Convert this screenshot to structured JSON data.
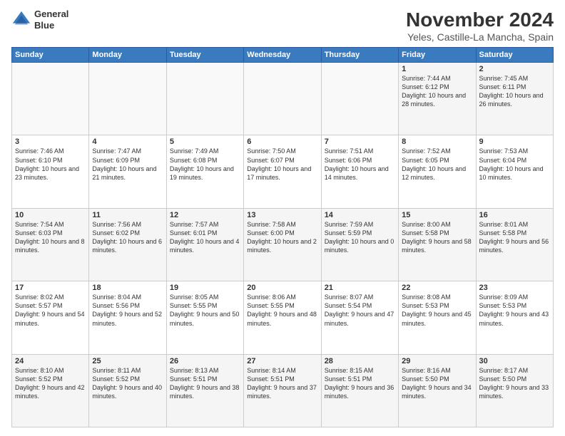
{
  "header": {
    "logo_line1": "General",
    "logo_line2": "Blue",
    "title": "November 2024",
    "subtitle": "Yeles, Castille-La Mancha, Spain"
  },
  "weekdays": [
    "Sunday",
    "Monday",
    "Tuesday",
    "Wednesday",
    "Thursday",
    "Friday",
    "Saturday"
  ],
  "weeks": [
    [
      {
        "day": "",
        "sunrise": "",
        "sunset": "",
        "daylight": ""
      },
      {
        "day": "",
        "sunrise": "",
        "sunset": "",
        "daylight": ""
      },
      {
        "day": "",
        "sunrise": "",
        "sunset": "",
        "daylight": ""
      },
      {
        "day": "",
        "sunrise": "",
        "sunset": "",
        "daylight": ""
      },
      {
        "day": "",
        "sunrise": "",
        "sunset": "",
        "daylight": ""
      },
      {
        "day": "1",
        "sunrise": "Sunrise: 7:44 AM",
        "sunset": "Sunset: 6:12 PM",
        "daylight": "Daylight: 10 hours and 28 minutes."
      },
      {
        "day": "2",
        "sunrise": "Sunrise: 7:45 AM",
        "sunset": "Sunset: 6:11 PM",
        "daylight": "Daylight: 10 hours and 26 minutes."
      }
    ],
    [
      {
        "day": "3",
        "sunrise": "Sunrise: 7:46 AM",
        "sunset": "Sunset: 6:10 PM",
        "daylight": "Daylight: 10 hours and 23 minutes."
      },
      {
        "day": "4",
        "sunrise": "Sunrise: 7:47 AM",
        "sunset": "Sunset: 6:09 PM",
        "daylight": "Daylight: 10 hours and 21 minutes."
      },
      {
        "day": "5",
        "sunrise": "Sunrise: 7:49 AM",
        "sunset": "Sunset: 6:08 PM",
        "daylight": "Daylight: 10 hours and 19 minutes."
      },
      {
        "day": "6",
        "sunrise": "Sunrise: 7:50 AM",
        "sunset": "Sunset: 6:07 PM",
        "daylight": "Daylight: 10 hours and 17 minutes."
      },
      {
        "day": "7",
        "sunrise": "Sunrise: 7:51 AM",
        "sunset": "Sunset: 6:06 PM",
        "daylight": "Daylight: 10 hours and 14 minutes."
      },
      {
        "day": "8",
        "sunrise": "Sunrise: 7:52 AM",
        "sunset": "Sunset: 6:05 PM",
        "daylight": "Daylight: 10 hours and 12 minutes."
      },
      {
        "day": "9",
        "sunrise": "Sunrise: 7:53 AM",
        "sunset": "Sunset: 6:04 PM",
        "daylight": "Daylight: 10 hours and 10 minutes."
      }
    ],
    [
      {
        "day": "10",
        "sunrise": "Sunrise: 7:54 AM",
        "sunset": "Sunset: 6:03 PM",
        "daylight": "Daylight: 10 hours and 8 minutes."
      },
      {
        "day": "11",
        "sunrise": "Sunrise: 7:56 AM",
        "sunset": "Sunset: 6:02 PM",
        "daylight": "Daylight: 10 hours and 6 minutes."
      },
      {
        "day": "12",
        "sunrise": "Sunrise: 7:57 AM",
        "sunset": "Sunset: 6:01 PM",
        "daylight": "Daylight: 10 hours and 4 minutes."
      },
      {
        "day": "13",
        "sunrise": "Sunrise: 7:58 AM",
        "sunset": "Sunset: 6:00 PM",
        "daylight": "Daylight: 10 hours and 2 minutes."
      },
      {
        "day": "14",
        "sunrise": "Sunrise: 7:59 AM",
        "sunset": "Sunset: 5:59 PM",
        "daylight": "Daylight: 10 hours and 0 minutes."
      },
      {
        "day": "15",
        "sunrise": "Sunrise: 8:00 AM",
        "sunset": "Sunset: 5:58 PM",
        "daylight": "Daylight: 9 hours and 58 minutes."
      },
      {
        "day": "16",
        "sunrise": "Sunrise: 8:01 AM",
        "sunset": "Sunset: 5:58 PM",
        "daylight": "Daylight: 9 hours and 56 minutes."
      }
    ],
    [
      {
        "day": "17",
        "sunrise": "Sunrise: 8:02 AM",
        "sunset": "Sunset: 5:57 PM",
        "daylight": "Daylight: 9 hours and 54 minutes."
      },
      {
        "day": "18",
        "sunrise": "Sunrise: 8:04 AM",
        "sunset": "Sunset: 5:56 PM",
        "daylight": "Daylight: 9 hours and 52 minutes."
      },
      {
        "day": "19",
        "sunrise": "Sunrise: 8:05 AM",
        "sunset": "Sunset: 5:55 PM",
        "daylight": "Daylight: 9 hours and 50 minutes."
      },
      {
        "day": "20",
        "sunrise": "Sunrise: 8:06 AM",
        "sunset": "Sunset: 5:55 PM",
        "daylight": "Daylight: 9 hours and 48 minutes."
      },
      {
        "day": "21",
        "sunrise": "Sunrise: 8:07 AM",
        "sunset": "Sunset: 5:54 PM",
        "daylight": "Daylight: 9 hours and 47 minutes."
      },
      {
        "day": "22",
        "sunrise": "Sunrise: 8:08 AM",
        "sunset": "Sunset: 5:53 PM",
        "daylight": "Daylight: 9 hours and 45 minutes."
      },
      {
        "day": "23",
        "sunrise": "Sunrise: 8:09 AM",
        "sunset": "Sunset: 5:53 PM",
        "daylight": "Daylight: 9 hours and 43 minutes."
      }
    ],
    [
      {
        "day": "24",
        "sunrise": "Sunrise: 8:10 AM",
        "sunset": "Sunset: 5:52 PM",
        "daylight": "Daylight: 9 hours and 42 minutes."
      },
      {
        "day": "25",
        "sunrise": "Sunrise: 8:11 AM",
        "sunset": "Sunset: 5:52 PM",
        "daylight": "Daylight: 9 hours and 40 minutes."
      },
      {
        "day": "26",
        "sunrise": "Sunrise: 8:13 AM",
        "sunset": "Sunset: 5:51 PM",
        "daylight": "Daylight: 9 hours and 38 minutes."
      },
      {
        "day": "27",
        "sunrise": "Sunrise: 8:14 AM",
        "sunset": "Sunset: 5:51 PM",
        "daylight": "Daylight: 9 hours and 37 minutes."
      },
      {
        "day": "28",
        "sunrise": "Sunrise: 8:15 AM",
        "sunset": "Sunset: 5:51 PM",
        "daylight": "Daylight: 9 hours and 36 minutes."
      },
      {
        "day": "29",
        "sunrise": "Sunrise: 8:16 AM",
        "sunset": "Sunset: 5:50 PM",
        "daylight": "Daylight: 9 hours and 34 minutes."
      },
      {
        "day": "30",
        "sunrise": "Sunrise: 8:17 AM",
        "sunset": "Sunset: 5:50 PM",
        "daylight": "Daylight: 9 hours and 33 minutes."
      }
    ]
  ]
}
